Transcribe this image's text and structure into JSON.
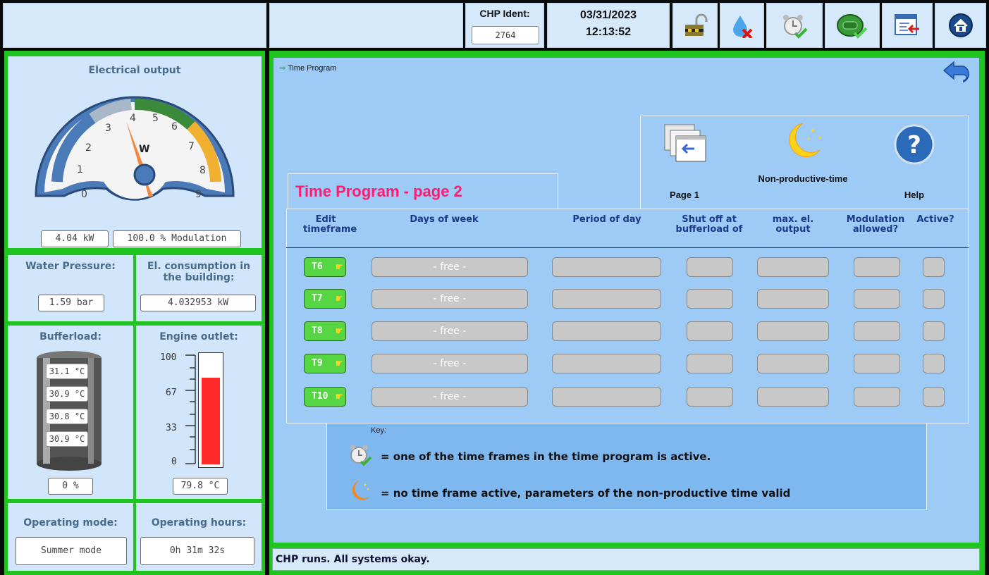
{
  "header": {
    "chp_ident_label": "CHP Ident:",
    "chp_ident_value": "2764",
    "date": "03/31/2023",
    "time": "12:13:52",
    "icons": [
      "unlock-icon",
      "water-alarm-icon",
      "alarm-clock-check-icon",
      "engine-ok-icon",
      "logout-screen-icon",
      "home-icon"
    ]
  },
  "left": {
    "electrical_output_title": "Electrical output",
    "gauge_unit": "W",
    "gauge_ticks": [
      "0",
      "1",
      "2",
      "3",
      "4",
      "5",
      "6",
      "7",
      "8",
      "9"
    ],
    "gauge_needle_value": 4.04,
    "power_value": "4.04 kW",
    "modulation_value": "100.0 % Modulation",
    "water_pressure_label": "Water Pressure:",
    "water_pressure_value": "1.59 bar",
    "el_consumption_label": "El. consumption in the building:",
    "el_consumption_value": "4.032953 kW",
    "bufferload_label": "Bufferload:",
    "buffer_temps": [
      "31.1 °C",
      "30.9 °C",
      "30.8 °C",
      "30.9 °C"
    ],
    "bufferload_value": "0 %",
    "engine_outlet_label": "Engine outlet:",
    "engine_scale": [
      "100",
      "67",
      "33",
      "0"
    ],
    "engine_fill_percent": 79.8,
    "engine_outlet_value": "79.8 °C",
    "operating_mode_label": "Operating mode:",
    "operating_mode_value": "Summer mode",
    "operating_hours_label": "Operating hours:",
    "operating_hours_value": "0h 31m 32s"
  },
  "main": {
    "breadcrumb": "Time Program",
    "title": "Time Program - page 2",
    "nav": {
      "page1_label": "Page 1",
      "nonprod_label": "Non-productive-time",
      "help_label": "Help"
    },
    "columns": {
      "edit": "Edit timeframe",
      "days": "Days of week",
      "period": "Period of day",
      "shutoff": "Shut off at bufferload of",
      "maxel": "max. el. output",
      "modulation": "Modulation allowed?",
      "active": "Active?"
    },
    "rows": [
      {
        "id": "T6",
        "days": "- free -"
      },
      {
        "id": "T7",
        "days": "- free -"
      },
      {
        "id": "T8",
        "days": "- free -"
      },
      {
        "id": "T9",
        "days": "- free -"
      },
      {
        "id": "T10",
        "days": "- free -"
      }
    ],
    "key": {
      "label": "Key:",
      "line1": "= one of the time frames in the time program is active.",
      "line2": "= no time frame active, parameters of the non-productive time valid"
    }
  },
  "status": "CHP runs. All systems okay.",
  "colors": {
    "accent_green": "#1fc41f",
    "title_pink": "#ff1b72",
    "panel_blue": "#9ecbf5"
  }
}
